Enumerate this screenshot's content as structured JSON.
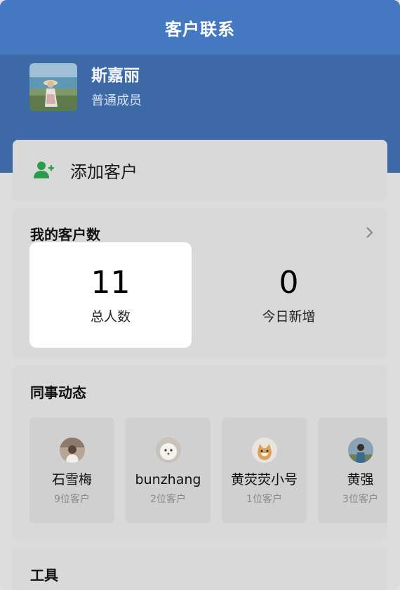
{
  "header": {
    "title": "客户联系"
  },
  "profile": {
    "name": "斯嘉丽",
    "role": "普通成员",
    "avatar_icon": "user-avatar-photo"
  },
  "add_customer": {
    "label": "添加客户",
    "icon": "add-person-icon",
    "accent": "#2a9d4a"
  },
  "customer_count": {
    "title": "我的客户数",
    "total": {
      "value": "11",
      "label": "总人数"
    },
    "today": {
      "value": "0",
      "label": "今日新增"
    }
  },
  "colleagues": {
    "title": "同事动态",
    "items": [
      {
        "name": "石雪梅",
        "count": "9位客户"
      },
      {
        "name": "bunzhang",
        "count": "2位客户"
      },
      {
        "name": "黄荧荧小号",
        "count": "1位客户"
      },
      {
        "name": "黄强",
        "count": "3位客户"
      }
    ]
  },
  "tools": {
    "title": "工具"
  },
  "colors": {
    "header_blue": "#4479c2",
    "profile_blue": "#3d6aa6",
    "card_gray": "#d9d9d9"
  }
}
